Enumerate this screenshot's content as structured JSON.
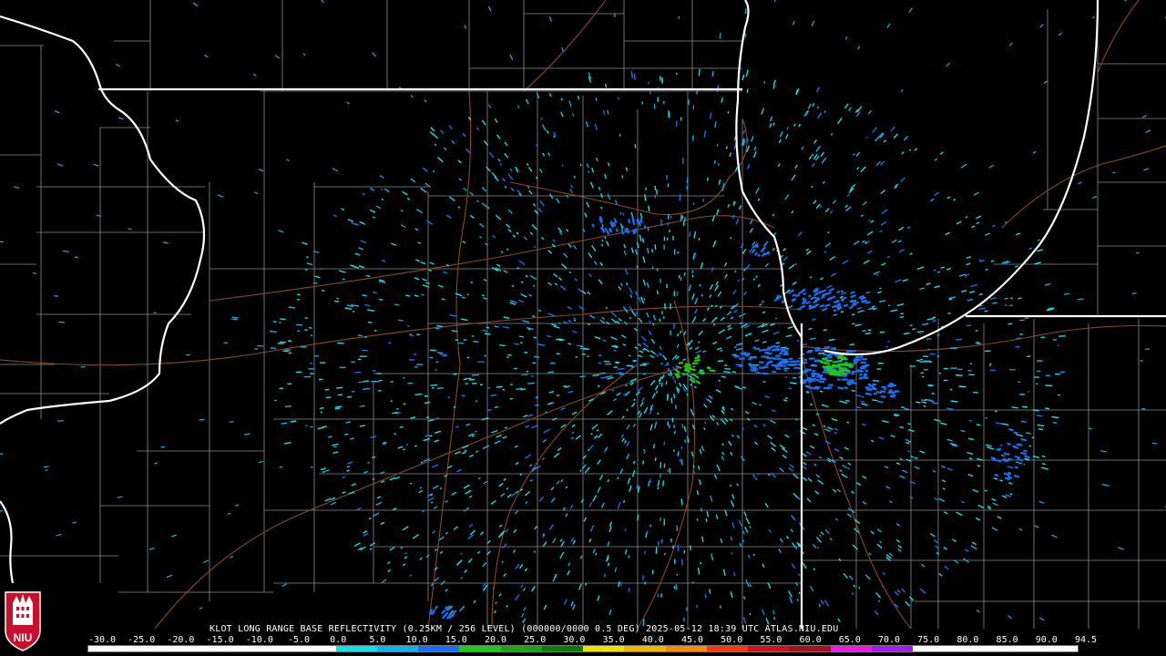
{
  "caption": "KLOT LONG RANGE BASE REFLECTIVITY (0.25KM / 256 LEVEL) (000000/0000 0.5 DEG) 2025-05-12 18:39 UTC  ATLAS.NIU.EDU",
  "logo": {
    "text": "NIU",
    "icon": "niu-logo-icon",
    "color": "#c8102e"
  },
  "colors": {
    "background": "#000000",
    "state_border": "#ffffff",
    "county_border": "#8c8c8c",
    "highway": "#8b4a2a"
  },
  "scale": {
    "labels": [
      "-30.0",
      "-25.0",
      "-20.0",
      "-15.0",
      "-10.0",
      "-5.0",
      "0.0",
      "5.0",
      "10.0",
      "15.0",
      "20.0",
      "25.0",
      "30.0",
      "35.0",
      "40.0",
      "45.0",
      "50.0",
      "55.0",
      "60.0",
      "65.0",
      "70.0",
      "75.0",
      "80.0",
      "85.0",
      "90.0",
      "94.5"
    ],
    "colors": [
      "#ffffff",
      "#ffffff",
      "#ffffff",
      "#ffffff",
      "#ffffff",
      "#ffffff",
      "#1fd9e0",
      "#18aee8",
      "#1c6ef0",
      "#23c61a",
      "#1aa414",
      "#0e7a0e",
      "#e8e214",
      "#ebb414",
      "#f08c14",
      "#f03c14",
      "#c8141e",
      "#a0141e",
      "#e41ee4",
      "#a01ee0",
      "#ffffff",
      "#ffffff",
      "#ffffff",
      "#ffffff"
    ]
  }
}
